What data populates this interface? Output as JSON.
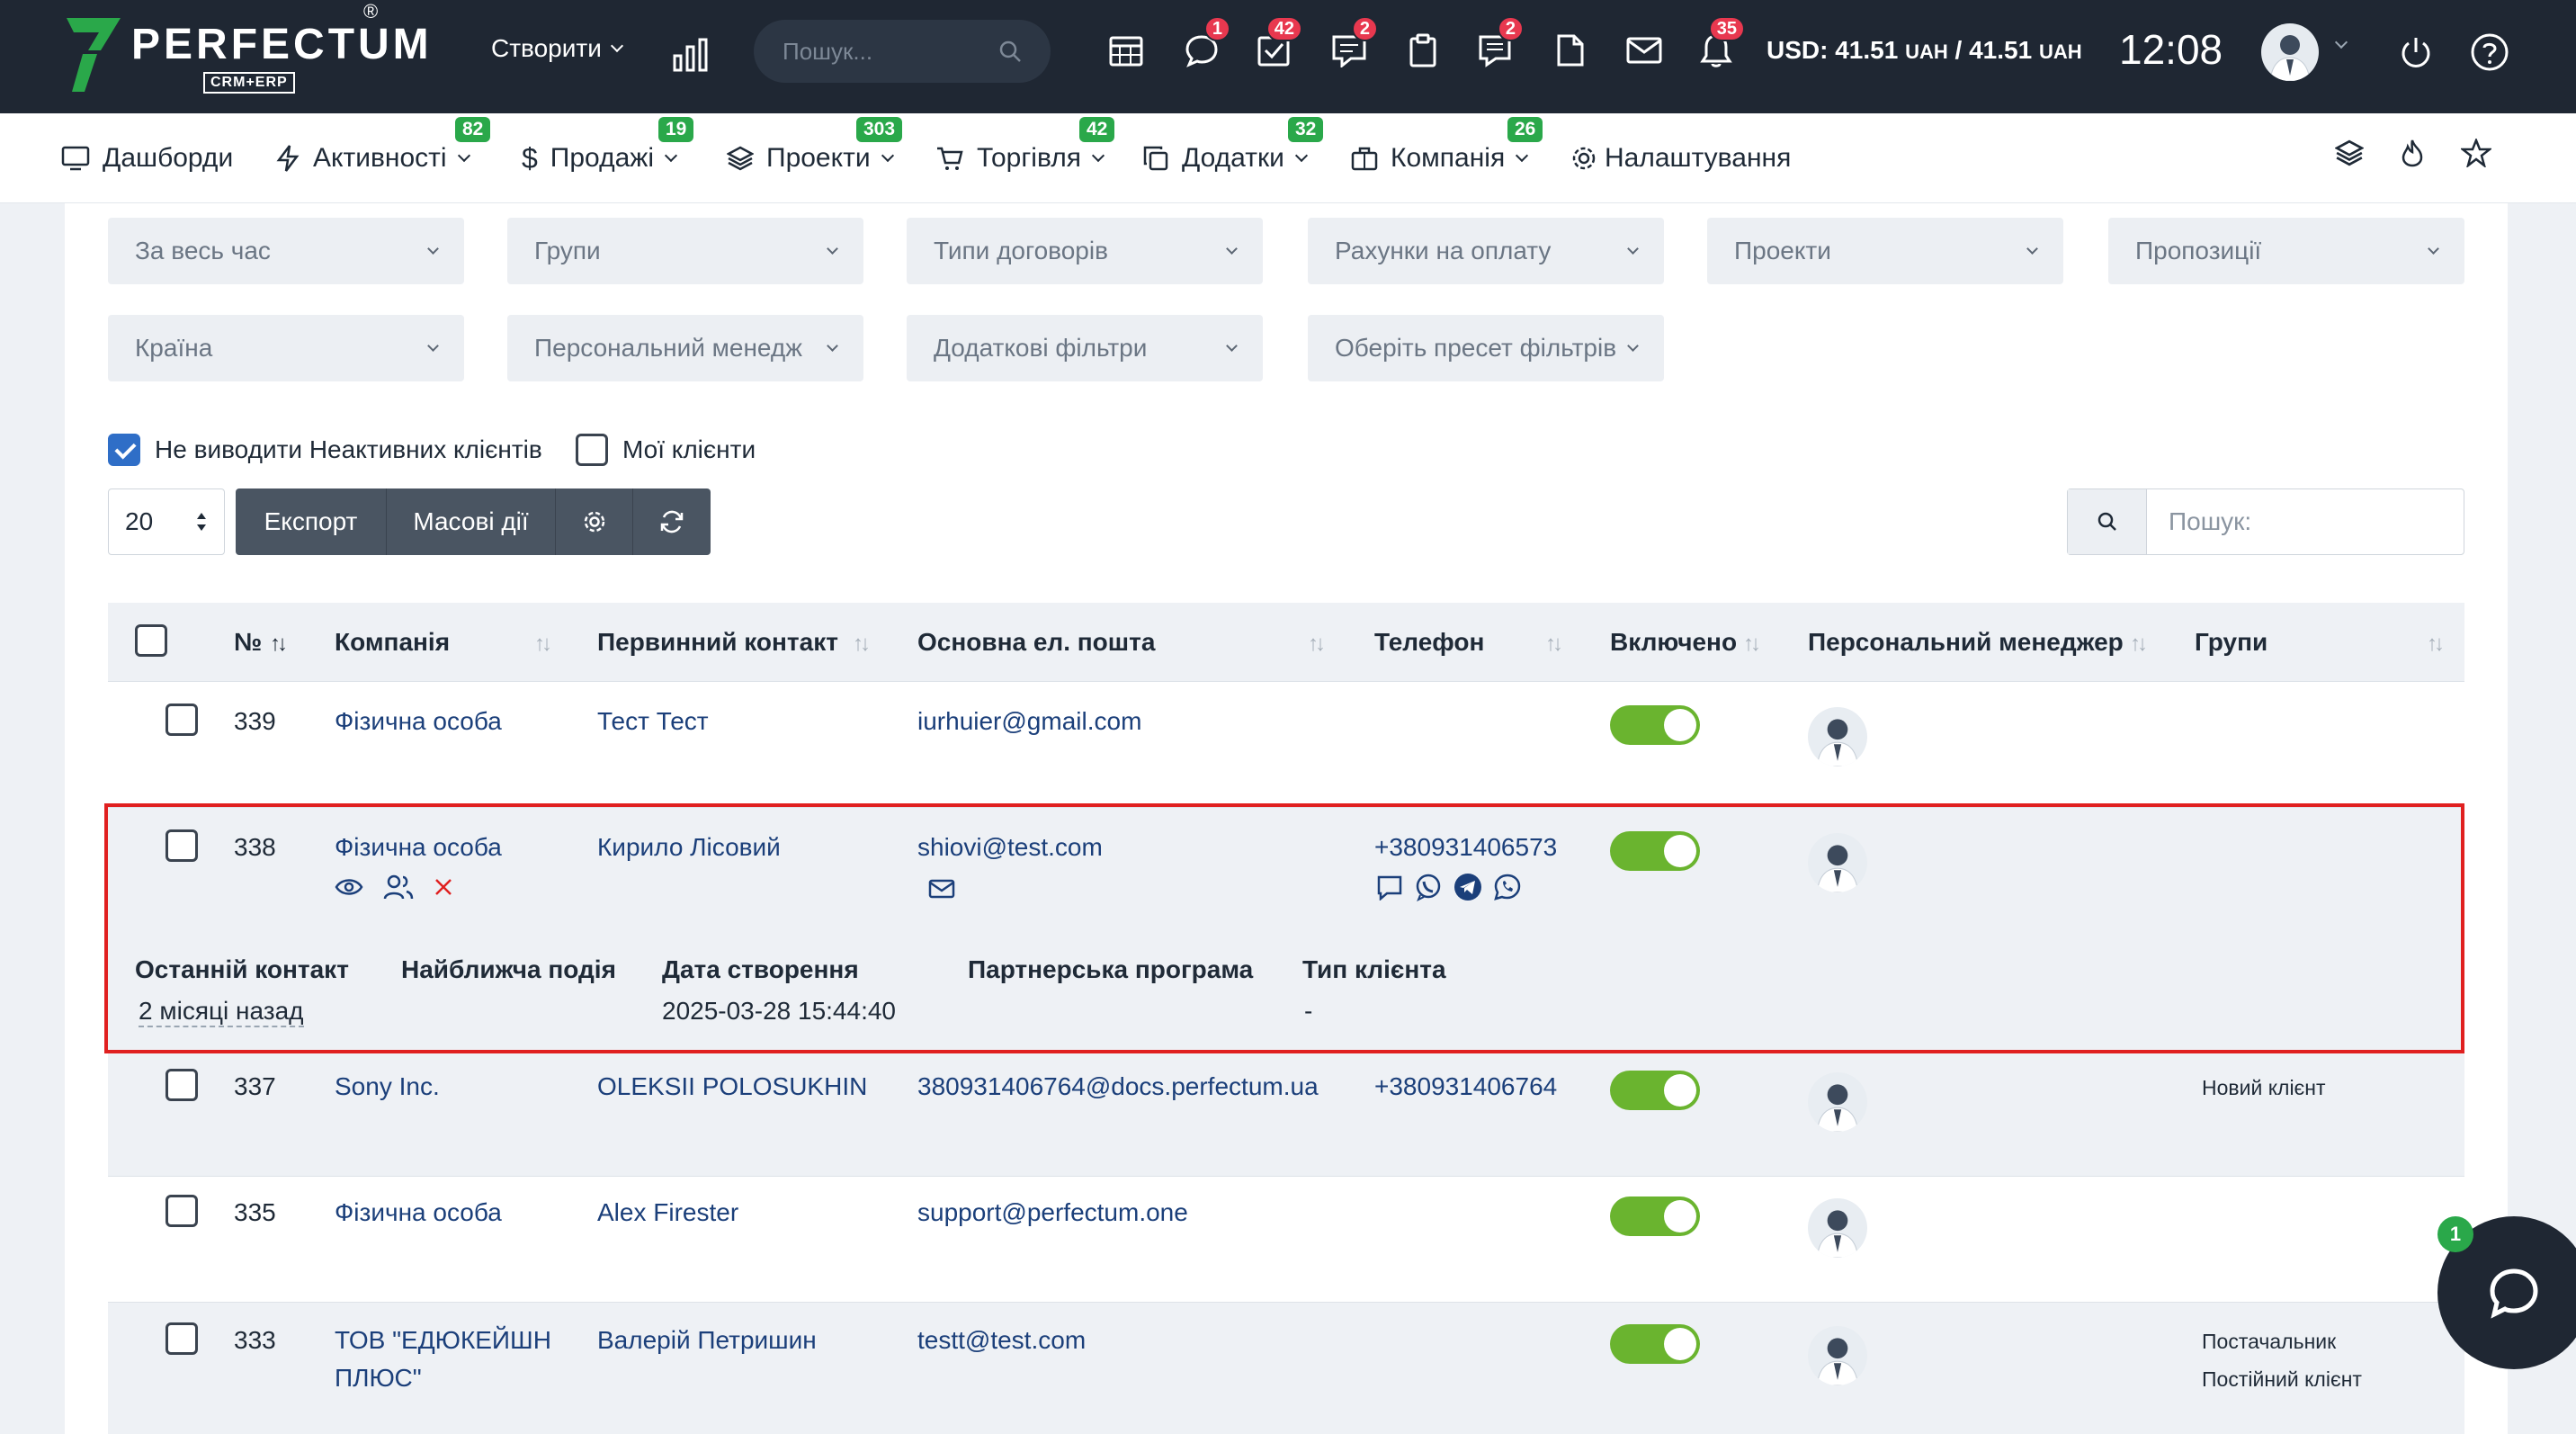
{
  "topbar": {
    "brand": "PERFECTUM",
    "brand_sub": "CRM+ERP",
    "reg_mark": "®",
    "create_label": "Створити",
    "search_placeholder": "Пошук...",
    "icons": [
      {
        "name": "calendar-icon",
        "badge": ""
      },
      {
        "name": "chat-icon",
        "badge": "1"
      },
      {
        "name": "tasks-icon",
        "badge": "42"
      },
      {
        "name": "messages-icon",
        "badge": "2"
      },
      {
        "name": "clipboard-icon",
        "badge": ""
      },
      {
        "name": "notes-icon",
        "badge": "2"
      },
      {
        "name": "document-icon",
        "badge": ""
      },
      {
        "name": "mail-icon",
        "badge": ""
      },
      {
        "name": "bell-icon",
        "badge": "35"
      }
    ],
    "currency_usd": "USD: 41.51",
    "currency_uah": "UAH",
    "currency_sep": "/ 41.51",
    "currency_uah2": "UAH",
    "time": "12:08"
  },
  "nav": {
    "items": [
      {
        "label": "Дашборди",
        "badge": ""
      },
      {
        "label": "Активності",
        "badge": "82"
      },
      {
        "label": "Продажі",
        "badge": "19"
      },
      {
        "label": "Проекти",
        "badge": "303"
      },
      {
        "label": "Торгівля",
        "badge": "42"
      },
      {
        "label": "Додатки",
        "badge": "32"
      },
      {
        "label": "Компанія",
        "badge": "26"
      },
      {
        "label": "Налаштування",
        "badge": ""
      }
    ]
  },
  "filters": {
    "row1": [
      "За весь час",
      "Групи",
      "Типи договорів",
      "Рахунки на оплату",
      "Проекти",
      "Пропозиції"
    ],
    "row2": [
      "Країна",
      "Персональний менедж",
      "Додаткові фільтри",
      "Оберіть пресет фільтрів"
    ]
  },
  "options": {
    "hide_inactive": "Не виводити Неактивних клієнтів",
    "my_clients": "Мої клієнти"
  },
  "toolbar": {
    "per_page": "20",
    "export": "Експорт",
    "mass": "Масові дії",
    "search_placeholder": "Пошук:"
  },
  "table": {
    "headers": [
      "№",
      "Компанія",
      "Первинний контакт",
      "Основна ел. пошта",
      "Телефон",
      "Включено",
      "Персональний менеджер",
      "Групи"
    ],
    "rows": [
      {
        "id": "339",
        "company": "Фізична особа",
        "contact": "Тест Тест",
        "email": "iurhuier@gmail.com",
        "phone": "",
        "enabled": true,
        "groups": []
      },
      {
        "id": "338",
        "company": "Фізична особа",
        "contact": "Кирило Лісовий",
        "email": "shiovi@test.com",
        "phone": "+380931406573",
        "enabled": true,
        "groups": []
      },
      {
        "id": "337",
        "company": "Sony Inc.",
        "contact": "OLEKSII POLOSUKHIN",
        "email": "380931406764@docs.perfectum.ua",
        "phone": "+380931406764",
        "enabled": true,
        "groups": [
          "Новий клієнт"
        ]
      },
      {
        "id": "335",
        "company": "Фізична особа",
        "contact": "Alex Firester",
        "email": "support@perfectum.one",
        "phone": "",
        "enabled": true,
        "groups": []
      },
      {
        "id": "333",
        "company_line1": "ТОВ \"ЕДЮКЕЙШН",
        "company_line2": "ПЛЮС\"",
        "contact": "Валерій Петришин",
        "email": "testt@test.com",
        "phone": "",
        "enabled": true,
        "groups": [
          "Постачальник",
          "Постійний клієнт"
        ]
      }
    ],
    "expanded": {
      "headers": [
        "Останній контакт",
        "Найближча подія",
        "Дата створення",
        "Партнерська програма",
        "Тип клієнта"
      ],
      "last_contact": "2 місяці назад",
      "created": "2025-03-28 15:44:40",
      "client_type": "-"
    }
  },
  "chat": {
    "badge": "1"
  },
  "colors": {
    "topbar": "#1f2733",
    "badge_red": "#e8384f",
    "badge_green": "#2aa84a",
    "toggle_on": "#6ab42f",
    "highlight": "#e02020"
  }
}
